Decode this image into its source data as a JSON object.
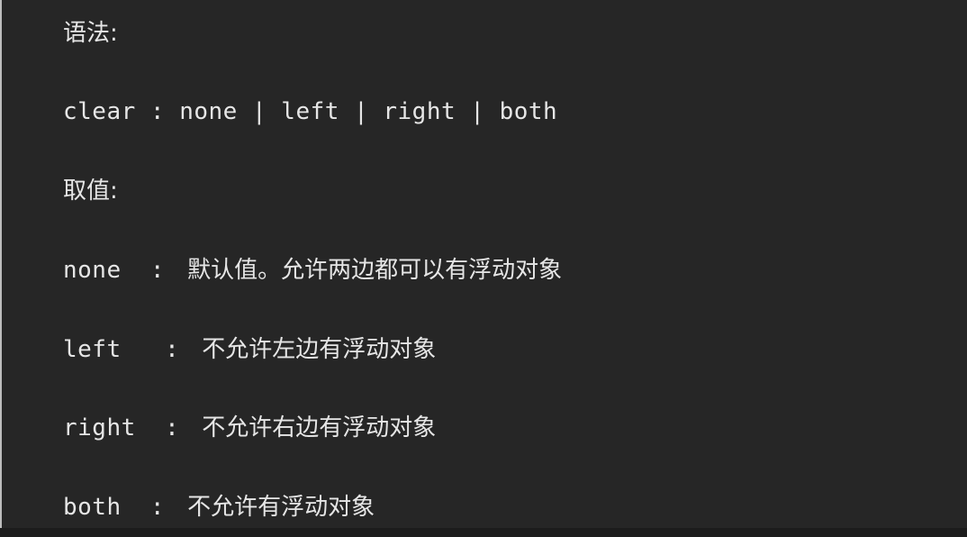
{
  "doc": {
    "syntax_label": "语法:",
    "syntax_line": "clear : none | left | right | both",
    "values_label": "取值:",
    "values": [
      {
        "key": "none  :",
        "desc": "默认值。允许两边都可以有浮动对象"
      },
      {
        "key": "left   :",
        "desc": "不允许左边有浮动对象"
      },
      {
        "key": "right  :",
        "desc": "不允许右边有浮动对象"
      },
      {
        "key": "both  :",
        "desc": "不允许有浮动对象"
      }
    ]
  }
}
